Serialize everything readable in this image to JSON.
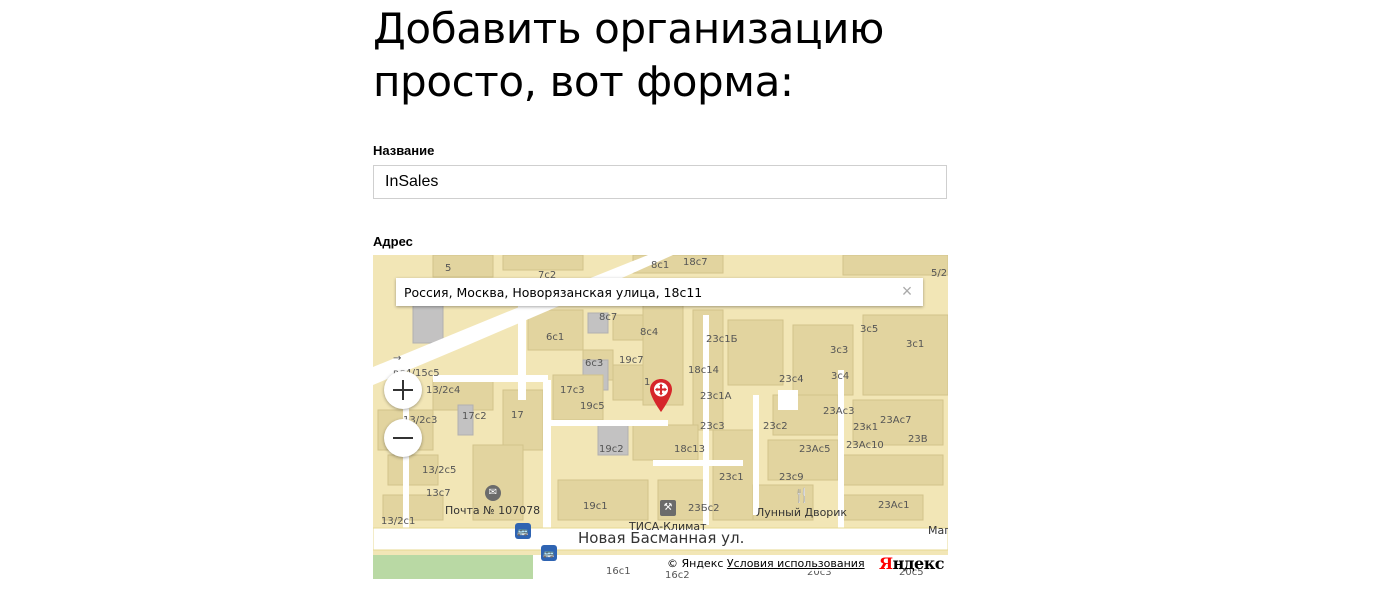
{
  "heading": {
    "line1": "Добавить организацию",
    "line2": "просто, вот форма:"
  },
  "form": {
    "name_label": "Название",
    "name_value": "InSales",
    "address_label": "Адрес"
  },
  "map": {
    "search_value": "Россия, Москва, Новорязанская улица, 18с11",
    "clear_glyph": "×",
    "zoom_in_glyph": "+",
    "zoom_out_glyph": "−",
    "copyright_prefix": "© Яндекс",
    "terms_link": "Условия использования",
    "logo_first": "Я",
    "logo_rest": "ндекс",
    "street_label": "Новая Басманная ул.",
    "pois": {
      "post_office": "Почта № 107078",
      "tisa": "ТИСА-Климат",
      "lunny": "Лунный Дворик",
      "mag": "Маг"
    },
    "building_labels": {
      "b5": "5",
      "b7c2": "7с2",
      "b8c1": "8с1",
      "b18c7": "18с7",
      "b5_2": "5/2",
      "b8c7": "8с7",
      "b8c4": "8с4",
      "b23c16": "23с1Б",
      "b3c5": "3с5",
      "b3c1": "3с1",
      "b6c1": "6с1",
      "b6c3": "6с3",
      "b19c7": "19с7",
      "b18c14": "18с14",
      "b3c3": "3с3",
      "b23c4": "23с4",
      "b3c4": "3с4",
      "bvl4": "вл4/15с5",
      "b13_2c4": "13/2с4",
      "b17c3": "17с3",
      "b19c5": "19с5",
      "b23c1a": "23с1А",
      "b23ac3": "23Ас3",
      "b13_2c3": "13/2с3",
      "b17c2": "17с2",
      "b17": "17",
      "b23ac7": "23Ас7",
      "b23c3": "23с3",
      "b23c2": "23с2",
      "b23k1": "23к1",
      "b23ac10": "23Ас10",
      "b23v": "23В",
      "b19c2": "19с2",
      "b18c13": "18с13",
      "b23ac5": "23Ас5",
      "b13_2c5": "13/2с5",
      "b23c1": "23с1",
      "b23c9": "23с9",
      "b13c7": "13с7",
      "b19c1": "19с1",
      "b23bc2": "23Бс2",
      "b23ac1": "23Ас1",
      "b13_2c1": "13/2с1",
      "b16c1": "16с1",
      "b16c2": "16с2",
      "b20c3": "20с3",
      "b20c5": "20с5",
      "b1": "1",
      "arrow": "→"
    }
  },
  "colors": {
    "map_ground": "#f2e6b6",
    "building": "#e2d49f",
    "pin": "#d6262b",
    "bus": "#2f64b2",
    "logo_red": "#ff0000"
  }
}
